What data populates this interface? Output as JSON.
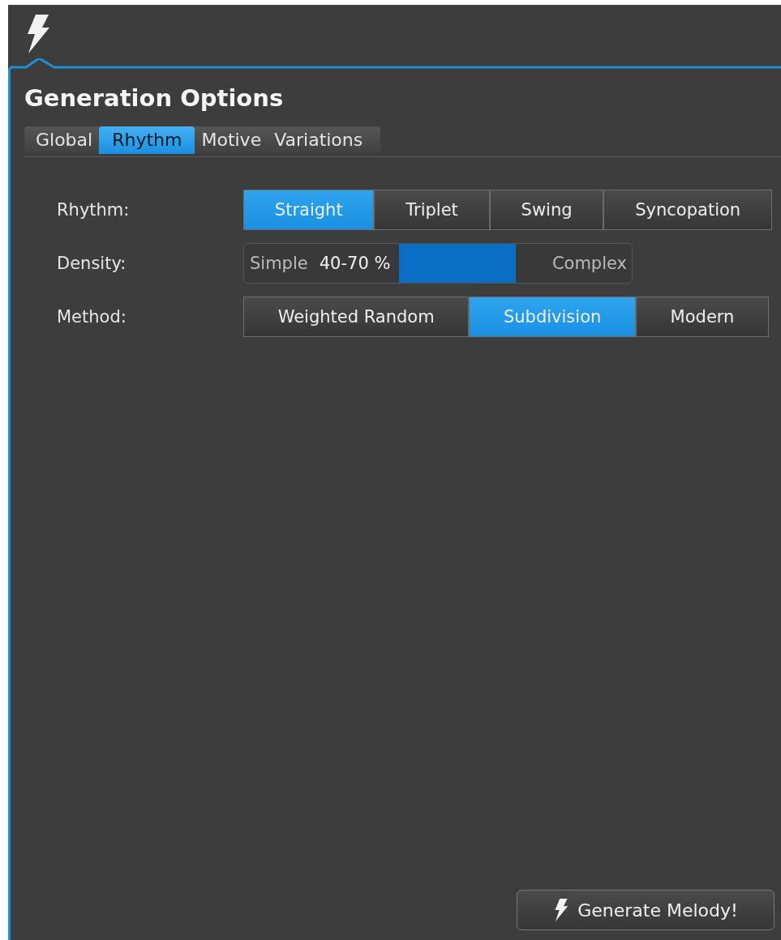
{
  "panel": {
    "title": "Generation Options"
  },
  "tabs": [
    {
      "label": "Global",
      "selected": false
    },
    {
      "label": "Rhythm",
      "selected": true
    },
    {
      "label": "Motive",
      "selected": false
    },
    {
      "label": "Variations",
      "selected": false
    }
  ],
  "rhythm": {
    "label": "Rhythm:",
    "options": [
      {
        "label": "Straight",
        "selected": true
      },
      {
        "label": "Triplet",
        "selected": false
      },
      {
        "label": "Swing",
        "selected": false
      },
      {
        "label": "Syncopation",
        "selected": false
      }
    ]
  },
  "density": {
    "label": "Density:",
    "min_label": "Simple",
    "max_label": "Complex",
    "reading": "40-70 %"
  },
  "method": {
    "label": "Method:",
    "options": [
      {
        "label": "Weighted Random",
        "selected": false
      },
      {
        "label": "Subdivision",
        "selected": true
      },
      {
        "label": "Modern",
        "selected": false
      }
    ]
  },
  "generate_button": {
    "label": "Generate Melody!"
  }
}
